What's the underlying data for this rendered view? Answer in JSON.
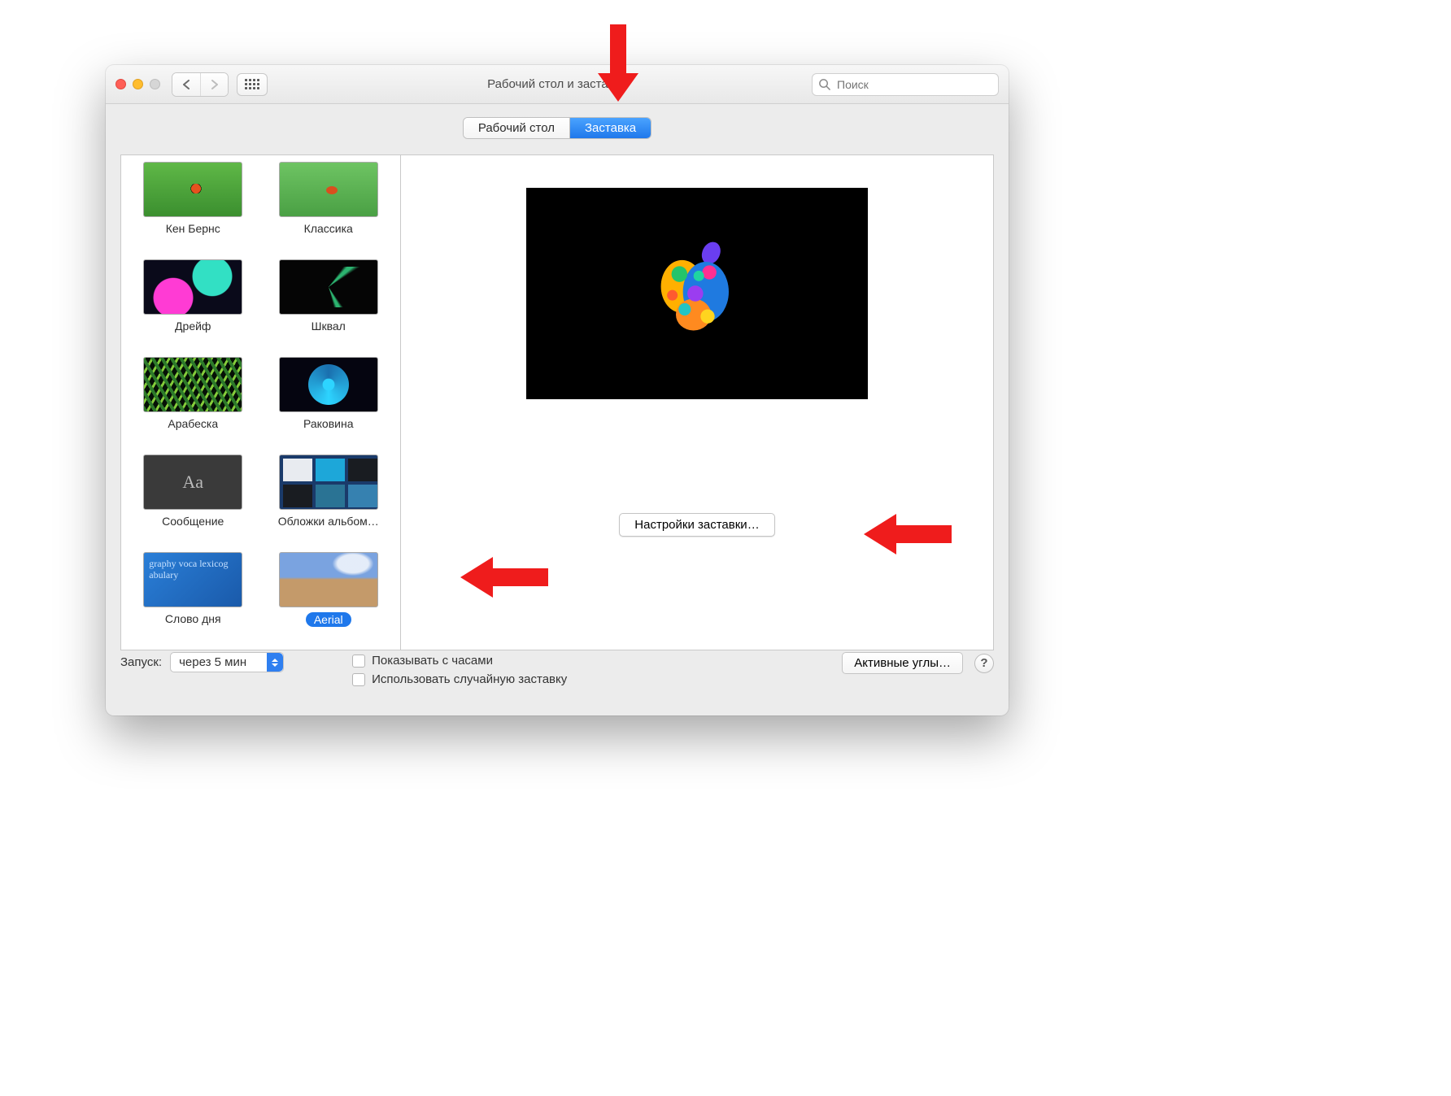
{
  "title": "Рабочий стол и заставка",
  "search_placeholder": "Поиск",
  "tabs": {
    "desktop": "Рабочий стол",
    "screensaver": "Заставка"
  },
  "thumbs": [
    {
      "label": "Кен Бернс",
      "art": "art-ladybug"
    },
    {
      "label": "Классика",
      "art": "art-ladybug2"
    },
    {
      "label": "Дрейф",
      "art": "art-drift"
    },
    {
      "label": "Шквал",
      "art": "art-squall"
    },
    {
      "label": "Арабеска",
      "art": "art-arabesque"
    },
    {
      "label": "Раковина",
      "art": "art-shell"
    },
    {
      "label": "Сообщение",
      "art": "art-message",
      "inner": "Aa"
    },
    {
      "label": "Обложки альбом…",
      "art": "art-covers"
    },
    {
      "label": "Слово дня",
      "art": "art-word",
      "inner": "graphy voca lexicog abulary"
    },
    {
      "label": "Aerial",
      "art": "art-aerial",
      "selected": true
    }
  ],
  "options_button": "Настройки заставки…",
  "start_label": "Запуск:",
  "start_value": "через 5 мин",
  "check_clock": "Показывать с часами",
  "check_random": "Использовать случайную заставку",
  "hotcorners": "Активные углы…",
  "help": "?"
}
